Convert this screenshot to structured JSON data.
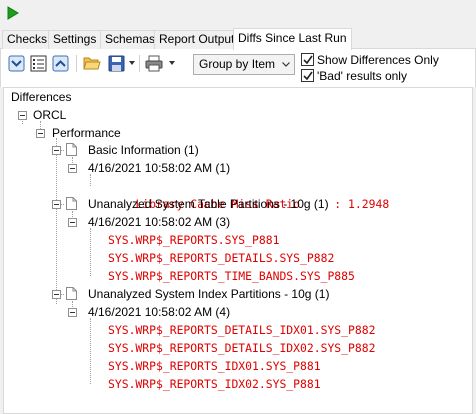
{
  "tabs": [
    {
      "label": "Checks"
    },
    {
      "label": "Settings"
    },
    {
      "label": "Schemas"
    },
    {
      "label": "Report Output"
    },
    {
      "label": "Diffs Since Last Run",
      "active": true
    }
  ],
  "toolbar": {
    "icons": [
      "run-icon",
      "expand-all-icon",
      "list-view-icon",
      "collapse-all-icon",
      "open-folder-icon",
      "save-icon",
      "print-icon"
    ],
    "group_by": {
      "selected": "Group by Item"
    },
    "show_differences_only": {
      "label": "Show Differences Only",
      "checked": true
    },
    "bad_results_only": {
      "label": "'Bad' results only",
      "checked": true
    }
  },
  "tree": {
    "root": "Differences",
    "database": "ORCL",
    "category": "Performance",
    "groups": [
      {
        "title": "Basic Information (1)",
        "runs": [
          {
            "timestamp": "4/16/2021 10:58:02 AM (1)",
            "items": [
              "Library Cache Miss Ratio     : 1.2948"
            ]
          }
        ]
      },
      {
        "title": "Unanalyzed System Table Partitions - 10g (1)",
        "runs": [
          {
            "timestamp": "4/16/2021 10:58:02 AM (3)",
            "items": [
              "SYS.WRP$_REPORTS.SYS_P881",
              "SYS.WRP$_REPORTS_DETAILS.SYS_P882",
              "SYS.WRP$_REPORTS_TIME_BANDS.SYS_P885"
            ]
          }
        ]
      },
      {
        "title": "Unanalyzed System Index Partitions - 10g (1)",
        "runs": [
          {
            "timestamp": "4/16/2021 10:58:02 AM (4)",
            "items": [
              "SYS.WRP$_REPORTS_DETAILS_IDX01.SYS_P882",
              "SYS.WRP$_REPORTS_DETAILS_IDX02.SYS_P882",
              "SYS.WRP$_REPORTS_IDX01.SYS_P881",
              "SYS.WRP$_REPORTS_IDX02.SYS_P881"
            ]
          }
        ]
      }
    ]
  },
  "colors": {
    "diff_text": "#e00000",
    "run_green": "#1ca01c"
  }
}
